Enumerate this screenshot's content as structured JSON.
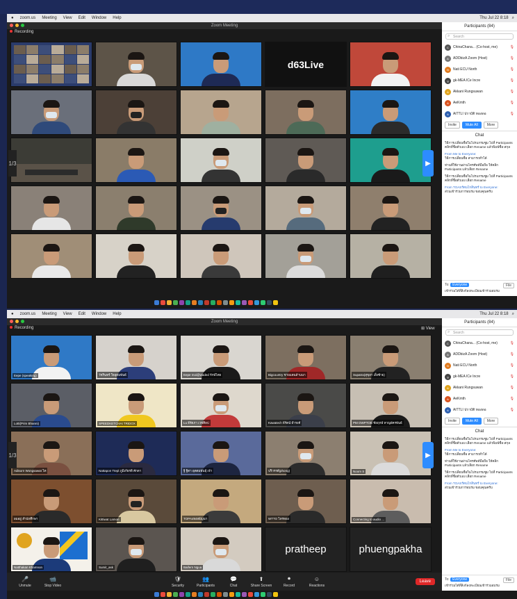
{
  "screenshot1": {
    "menubar": {
      "items": [
        "zoom.us",
        "Meeting",
        "View",
        "Edit",
        "Window",
        "Help"
      ],
      "clock": "Thu Jul 22 8:18"
    },
    "window_title": "Zoom Meeting",
    "recording_label": "Recording",
    "page_indicator": "1/3",
    "tiles": [
      {
        "name": "",
        "bg": "#2a3b6b",
        "type": "gallery"
      },
      {
        "name": "",
        "bg": "#5d5448",
        "type": "person",
        "mask": "m",
        "shirt": "#d9d9d9"
      },
      {
        "name": "",
        "bg": "#2e79c6",
        "type": "person",
        "mask": "",
        "shirt": "#1e2a55"
      },
      {
        "name": "",
        "bg": "#111111",
        "type": "text",
        "text": "d63Live",
        "text_color": "#ffffff",
        "accent": "#e02020"
      },
      {
        "name": "",
        "bg": "#c0483a",
        "type": "person",
        "mask": "",
        "shirt": "#f2f2f2"
      },
      {
        "name": "",
        "bg": "#6a6f7a",
        "type": "person",
        "mask": "m",
        "shirt": "#2f4a7a"
      },
      {
        "name": "",
        "bg": "#4c4037",
        "type": "person",
        "mask": "k",
        "shirt": "#333333"
      },
      {
        "name": "",
        "bg": "#b7a58e",
        "type": "person",
        "mask": "",
        "shirt": "#9fb0a0"
      },
      {
        "name": "",
        "bg": "#7d6e5f",
        "type": "person",
        "mask": "",
        "shirt": "#4d6a57"
      },
      {
        "name": "",
        "bg": "#2f7ec7",
        "type": "person",
        "mask": "",
        "shirt": "#2b2b2b"
      },
      {
        "name": "",
        "bg": "#3c3c36",
        "type": "room"
      },
      {
        "name": "",
        "bg": "#8a7c68",
        "type": "person",
        "mask": "",
        "shirt": "#2b5ab5"
      },
      {
        "name": "",
        "bg": "#cfd0c8",
        "type": "person",
        "mask": "m",
        "shirt": "#333333"
      },
      {
        "name": "",
        "bg": "#5f5a55",
        "type": "person",
        "mask": "",
        "shirt": "#2a2a2a"
      },
      {
        "name": "",
        "bg": "#1e9e8e",
        "type": "person",
        "mask": "",
        "shirt": "#1a1a1a"
      },
      {
        "name": "",
        "bg": "#8a8178",
        "type": "person",
        "mask": "",
        "shirt": "#e6e6e6"
      },
      {
        "name": "",
        "bg": "#8b7f6e",
        "type": "person",
        "mask": "",
        "shirt": "#2f3a2a"
      },
      {
        "name": "",
        "bg": "#9b9184",
        "type": "person",
        "mask": "k",
        "shirt": "#263b6e"
      },
      {
        "name": "",
        "bg": "#b4aa9c",
        "type": "person",
        "mask": "m",
        "shirt": "#566b7d"
      },
      {
        "name": "",
        "bg": "#8f7f6d",
        "type": "person",
        "mask": "",
        "shirt": "#222222"
      },
      {
        "name": "",
        "bg": "#a08e77",
        "type": "person",
        "mask": "",
        "shirt": "#e9e9e9"
      },
      {
        "name": "",
        "bg": "#d7d2c8",
        "type": "person",
        "mask": "",
        "shirt": "#222222"
      },
      {
        "name": "",
        "bg": "#cfc6bb",
        "type": "person",
        "mask": "",
        "shirt": "#3a3a3a"
      },
      {
        "name": "",
        "bg": "#a3a098",
        "type": "person",
        "mask": "m",
        "shirt": "#dcdcdc"
      },
      {
        "name": "",
        "bg": "#b6b1a4",
        "type": "person",
        "mask": "",
        "shirt": "#1f1f1f"
      }
    ]
  },
  "screenshot2": {
    "menubar": {
      "items": [
        "zoom.us",
        "Meeting",
        "View",
        "Edit",
        "Window",
        "Help"
      ],
      "clock": "Thu Jul 22 8:18"
    },
    "window_title": "Zoom Meeting",
    "recording_label": "Recording",
    "view_label": "View",
    "page_indicator": "1/3",
    "tiles": [
      {
        "name": "Eepe (speaking)",
        "bg": "#2f79c6",
        "type": "person",
        "mask": "",
        "shirt": "#f2f2f2"
      },
      {
        "name": "วัชรินทร์ ใจอุดมพันธ์",
        "bg": "#d6d2cc",
        "type": "person",
        "mask": "",
        "shirt": "#2c3e7a"
      },
      {
        "name": "Eepe moi@waded รักษ์ไทย",
        "bg": "#d9d6d0",
        "type": "person",
        "mask": "",
        "shirt": "#1a1a1a"
      },
      {
        "name": "Bigcountry ชายแดนล้านนา",
        "bg": "#7d6f60",
        "type": "person",
        "mask": "",
        "shirt": "#a02828"
      },
      {
        "name": "Supatra(สุขุลา เส็งซ้าย)",
        "bg": "#8a7f70",
        "type": "person",
        "mask": "",
        "shirt": "#222222"
      },
      {
        "name": "Lotti(Prim Bhanni)",
        "bg": "#5b5e66",
        "type": "person",
        "mask": "",
        "shirt": "#2a4b8e"
      },
      {
        "name": "SPEEDKETCHAI TRIDOX",
        "bg": "#efe6c6",
        "type": "person",
        "mask": "",
        "shirt": "#f0c820"
      },
      {
        "name": "Lu ธีรัตภา เวชศิลป",
        "bg": "#ded8cd",
        "type": "person",
        "mask": "m",
        "shirt": "#c23a3a"
      },
      {
        "name": "Kawatech ธีรัตน์ ธำรงค์",
        "bg": "#4a4a48",
        "type": "person",
        "mask": "",
        "shirt": "#3b3f4a"
      },
      {
        "name": "PM OWPTOB ชัยฤกษ์ หาญอัครพันธ์",
        "bg": "#c7bfb3",
        "type": "person",
        "mask": "",
        "shirt": "#1a1a1a"
      },
      {
        "name": "Adisorn Wongsawat ไท",
        "bg": "#8a6f58",
        "type": "person",
        "mask": "",
        "shirt": "#7a5040"
      },
      {
        "name": "Nattapon Ttepl ภูมิเกียรติ ศักดา",
        "bg": "#1e2b57",
        "type": "person",
        "mask": "",
        "shirt": "#2a2a40"
      },
      {
        "name": "ฐิ ฐิตา อุตตมพันธุ์ เจ้า",
        "bg": "#5a6a9b",
        "type": "person",
        "mask": "",
        "shirt": "#1d2540"
      },
      {
        "name": "ปริวรรต์(phong)",
        "bg": "#8c7f70",
        "type": "person",
        "mask": "m",
        "shirt": "#2c2c2c"
      },
      {
        "name": "Noom S",
        "bg": "#c9c1b4",
        "type": "person",
        "mask": "",
        "shirt": "#dbdbdb"
      },
      {
        "name": "ผมอยู่ สำนักศึกษา",
        "bg": "#7d4f2f",
        "type": "person",
        "mask": "",
        "shirt": "#2a2a2a"
      },
      {
        "name": "Kittiwat Lamon",
        "bg": "#5a4a3a",
        "type": "person",
        "mask": "k",
        "shirt": "#d8c8a0"
      },
      {
        "name": "TOPAsหงสธัญนา",
        "bg": "#c4a97e",
        "type": "person",
        "mask": "",
        "shirt": "#3b3b3b"
      },
      {
        "name": "WTTO ไทรทอง",
        "bg": "#6e5e4f",
        "type": "person",
        "mask": "",
        "shirt": "#2a2a2a"
      },
      {
        "name": "Connecting to audio ...",
        "bg": "#c9bcae",
        "type": "person",
        "mask": "",
        "shirt": "#5d5d5d"
      },
      {
        "name": "Natthakan Khamnon",
        "bg": "#f4f1ea",
        "type": "logo",
        "mask": "",
        "shirt": "#1c3b7a"
      },
      {
        "name": "Sumit_ask",
        "bg": "#5b5550",
        "type": "person",
        "mask": "m",
        "shirt": "#1f1f1f"
      },
      {
        "name": "Baifern Ngua",
        "bg": "#d3cbc0",
        "type": "person",
        "mask": "m",
        "shirt": "#d9d9d9"
      },
      {
        "name": "",
        "bg": "#222222",
        "type": "text",
        "text": "pratheep",
        "text_color": "#ffffff",
        "accent": ""
      },
      {
        "name": "",
        "bg": "#222222",
        "type": "text",
        "text": "phuengpakha",
        "text_color": "#ffffff",
        "accent": ""
      }
    ],
    "toolbar": [
      {
        "label": "Unmute",
        "icon": "🎤"
      },
      {
        "label": "Stop Video",
        "icon": "📹"
      },
      {
        "label": "Security",
        "icon": "🛡"
      },
      {
        "label": "Participants",
        "icon": "👥"
      },
      {
        "label": "Chat",
        "icon": "💬"
      },
      {
        "label": "Share Screen",
        "icon": "⬆"
      },
      {
        "label": "Record",
        "icon": "⏺"
      },
      {
        "label": "Reactions",
        "icon": "☺"
      }
    ],
    "leave_label": "Leave"
  },
  "panel": {
    "participants_title": "Participants (84)",
    "search_placeholder": "Search",
    "participants": [
      {
        "name": "ChinaChana... (Co-host, me)",
        "color": "#555555",
        "initial": "C"
      },
      {
        "name": "ADDbizA Zoom (Host)",
        "color": "#777777",
        "initial": "A"
      },
      {
        "name": "Nati ECU North",
        "color": "#e07b1f",
        "initial": "N"
      },
      {
        "name": "gk-MEA ICe Incre",
        "color": "#444444",
        "initial": "g"
      },
      {
        "name": "Akkani Rungsuwan",
        "color": "#e0a41f",
        "initial": "A"
      },
      {
        "name": "AeKmth",
        "color": "#d9531e",
        "initial": "A"
      },
      {
        "name": "AiTTLI ปราบัติ ทองดอ",
        "color": "#2d5fb0",
        "initial": "A"
      }
    ],
    "invite_label": "Invite",
    "mute_all_label": "Mute All",
    "more_label": "More",
    "chat_title": "Chat",
    "messages": [
      {
        "from": "",
        "text": "วิธีการเปลี่ยนชื่อในโปรแกรมซูม ไปที่ Participants คลิกที่ชื่อตัวเอง เลือก Rename แล้วพิมพ์ชื่อ-สกุล"
      },
      {
        "from": "From Me to Everyone:",
        "text": "วิธีการเปลี่ยนชื่อ สามารถทำได้"
      },
      {
        "from": "",
        "text": "ท่านที่ใช้งานผ่านโทรศัพท์มือถือ ให้คลิก Participants แล้วเลือก Rename"
      },
      {
        "from": "",
        "text": "วิธีการเปลี่ยนชื่อในโปรแกรมซูม ไปที่ Participants คลิกที่ชื่อตัวเอง เลือก Rename"
      },
      {
        "from": "From TOASรัตนโกสินทร์ to Everyone:",
        "text": "ส่วนเข้าร่วมการอบรม ขอบคุณครับ"
      }
    ],
    "to_label": "To:",
    "to_value": "Everyone",
    "file_label": "File",
    "footer_text": "เข้าร่วมได้ที่ลิงก์ลงทะเบียนเข้าร่วมอบรม"
  },
  "dock_colors": [
    "#3a7bd5",
    "#e94b3c",
    "#f2b134",
    "#4caf50",
    "#8e44ad",
    "#16a085",
    "#e67e22",
    "#2980b9",
    "#c0392b",
    "#27ae60",
    "#d35400",
    "#7f8c8d",
    "#f39c12",
    "#1abc9c",
    "#9b59b6",
    "#e74c3c",
    "#3498db",
    "#2ecc71",
    "#34495e",
    "#f1c40f"
  ]
}
